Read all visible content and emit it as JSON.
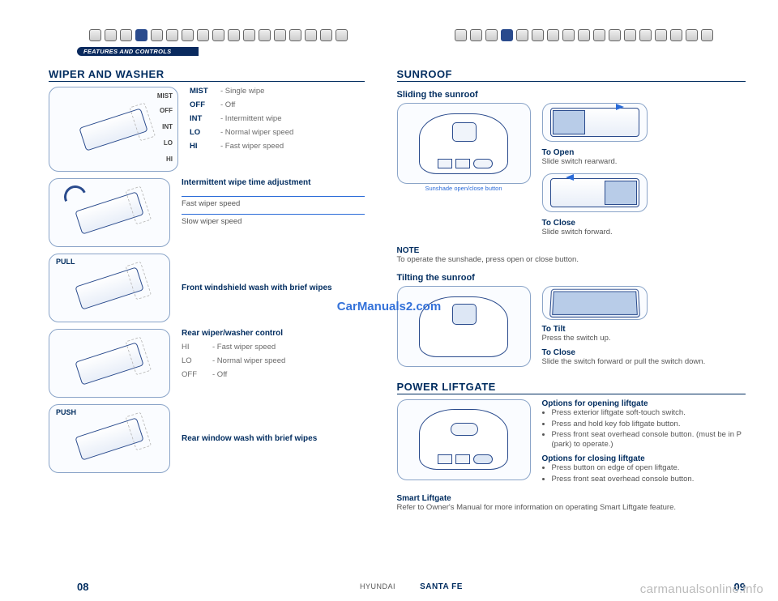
{
  "category": "FEATURES AND CONTROLS",
  "watermark": "CarManuals2.com",
  "site_watermark": "carmanualsonline.info",
  "footer": {
    "page_left": "08",
    "page_right": "09",
    "brand": "HYUNDAI",
    "model": "SANTA FE"
  },
  "left": {
    "title": "WIPER AND WASHER",
    "modes": {
      "mist": {
        "term": "MIST",
        "desc": "- Single wipe"
      },
      "off": {
        "term": "OFF",
        "desc": "- Off"
      },
      "int": {
        "term": "INT",
        "desc": "- Intermittent wipe"
      },
      "lo": {
        "term": "LO",
        "desc": "- Normal wiper speed"
      },
      "hi": {
        "term": "HI",
        "desc": "- Fast wiper speed"
      }
    },
    "stalk_labels": {
      "mist": "MIST",
      "off": "OFF",
      "int": "INT",
      "lo": "LO",
      "hi": "HI"
    },
    "intermittent": {
      "title": "Intermittent wipe time adjustment",
      "fast": "Fast wiper speed",
      "slow": "Slow wiper speed"
    },
    "pull": {
      "label": "PULL",
      "desc": "Front windshield wash with brief wipes"
    },
    "rear": {
      "title": "Rear wiper/washer control",
      "hi": {
        "term": "HI",
        "desc": "- Fast wiper speed"
      },
      "lo": {
        "term": "LO",
        "desc": "- Normal wiper speed"
      },
      "off": {
        "term": "OFF",
        "desc": "- Off"
      }
    },
    "push": {
      "label": "PUSH",
      "desc": "Rear window wash with brief wipes"
    }
  },
  "right": {
    "sunroof": {
      "title": "SUNROOF",
      "sliding": {
        "subhead": "Sliding the sunroof",
        "callout": "Sunshade open/close button",
        "open": {
          "label": "To Open",
          "desc": "Slide switch rearward."
        },
        "close": {
          "label": "To Close",
          "desc": "Slide switch forward."
        },
        "note_label": "NOTE",
        "note_text": "To operate the sunshade, press open or close button."
      },
      "tilting": {
        "subhead": "Tilting the sunroof",
        "tilt": {
          "label": "To Tilt",
          "desc": "Press the switch up."
        },
        "close": {
          "label": "To Close",
          "desc": "Slide the switch forward or pull the switch down."
        }
      }
    },
    "liftgate": {
      "title": "POWER LIFTGATE",
      "open_title": "Options for opening liftgate",
      "open_items": [
        "Press exterior liftgate soft-touch switch.",
        "Press and hold key fob liftgate button.",
        "Press front seat overhead console button. (must be in P (park) to operate.)"
      ],
      "close_title": "Options for closing liftgate",
      "close_items": [
        "Press button on edge of open liftgate.",
        "Press front seat overhead console button."
      ],
      "smart_title": "Smart Liftgate",
      "smart_text": "Refer to Owner's Manual for more information on operating Smart Liftgate feature."
    }
  }
}
